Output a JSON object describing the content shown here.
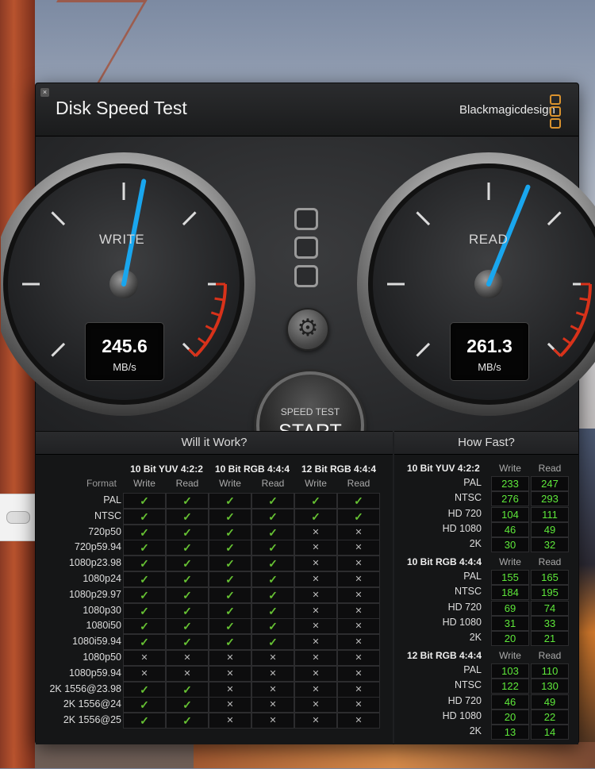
{
  "window": {
    "title": "Disk Speed Test",
    "brand": "Blackmagicdesign",
    "close": "×"
  },
  "gauges": {
    "write": {
      "label": "WRITE",
      "value": "245.6",
      "unit": "MB/s"
    },
    "read": {
      "label": "READ",
      "value": "261.3",
      "unit": "MB/s"
    }
  },
  "start_button": {
    "sub": "SPEED TEST",
    "main": "START"
  },
  "settings_icon": "⚙",
  "will_it_work": {
    "title": "Will it Work?",
    "format_header": "Format",
    "groups": [
      "10 Bit YUV 4:2:2",
      "10 Bit RGB 4:4:4",
      "12 Bit RGB 4:4:4"
    ],
    "sub_headers": [
      "Write",
      "Read"
    ],
    "rows": [
      {
        "format": "PAL",
        "cells": [
          1,
          1,
          1,
          1,
          1,
          1
        ]
      },
      {
        "format": "NTSC",
        "cells": [
          1,
          1,
          1,
          1,
          1,
          1
        ]
      },
      {
        "format": "720p50",
        "cells": [
          1,
          1,
          1,
          1,
          0,
          0
        ]
      },
      {
        "format": "720p59.94",
        "cells": [
          1,
          1,
          1,
          1,
          0,
          0
        ]
      },
      {
        "format": "1080p23.98",
        "cells": [
          1,
          1,
          1,
          1,
          0,
          0
        ]
      },
      {
        "format": "1080p24",
        "cells": [
          1,
          1,
          1,
          1,
          0,
          0
        ]
      },
      {
        "format": "1080p29.97",
        "cells": [
          1,
          1,
          1,
          1,
          0,
          0
        ]
      },
      {
        "format": "1080p30",
        "cells": [
          1,
          1,
          1,
          1,
          0,
          0
        ]
      },
      {
        "format": "1080i50",
        "cells": [
          1,
          1,
          1,
          1,
          0,
          0
        ]
      },
      {
        "format": "1080i59.94",
        "cells": [
          1,
          1,
          1,
          1,
          0,
          0
        ]
      },
      {
        "format": "1080p50",
        "cells": [
          0,
          0,
          0,
          0,
          0,
          0
        ]
      },
      {
        "format": "1080p59.94",
        "cells": [
          0,
          0,
          0,
          0,
          0,
          0
        ]
      },
      {
        "format": "2K 1556@23.98",
        "cells": [
          1,
          1,
          0,
          0,
          0,
          0
        ]
      },
      {
        "format": "2K 1556@24",
        "cells": [
          1,
          1,
          0,
          0,
          0,
          0
        ]
      },
      {
        "format": "2K 1556@25",
        "cells": [
          1,
          1,
          0,
          0,
          0,
          0
        ]
      }
    ],
    "check_glyph": "✓",
    "cross_glyph": "✕"
  },
  "how_fast": {
    "title": "How Fast?",
    "write_label": "Write",
    "read_label": "Read",
    "groups": [
      {
        "name": "10 Bit YUV 4:2:2",
        "rows": [
          {
            "format": "PAL",
            "write": "233",
            "read": "247"
          },
          {
            "format": "NTSC",
            "write": "276",
            "read": "293"
          },
          {
            "format": "HD 720",
            "write": "104",
            "read": "111"
          },
          {
            "format": "HD 1080",
            "write": "46",
            "read": "49"
          },
          {
            "format": "2K",
            "write": "30",
            "read": "32"
          }
        ]
      },
      {
        "name": "10 Bit RGB 4:4:4",
        "rows": [
          {
            "format": "PAL",
            "write": "155",
            "read": "165"
          },
          {
            "format": "NTSC",
            "write": "184",
            "read": "195"
          },
          {
            "format": "HD 720",
            "write": "69",
            "read": "74"
          },
          {
            "format": "HD 1080",
            "write": "31",
            "read": "33"
          },
          {
            "format": "2K",
            "write": "20",
            "read": "21"
          }
        ]
      },
      {
        "name": "12 Bit RGB 4:4:4",
        "rows": [
          {
            "format": "PAL",
            "write": "103",
            "read": "110"
          },
          {
            "format": "NTSC",
            "write": "122",
            "read": "130"
          },
          {
            "format": "HD 720",
            "write": "46",
            "read": "49"
          },
          {
            "format": "HD 1080",
            "write": "20",
            "read": "22"
          },
          {
            "format": "2K",
            "write": "13",
            "read": "14"
          }
        ]
      }
    ]
  },
  "colors": {
    "needle": "#19a6ee",
    "ok": "#66c133",
    "speed_value": "#5ee83a",
    "redline": "#d8321a",
    "logo": "#d9922e"
  }
}
